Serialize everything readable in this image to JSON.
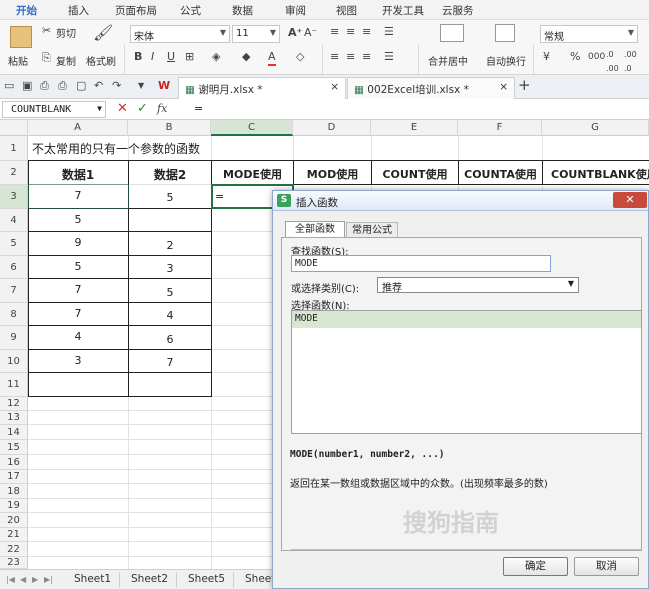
{
  "menu": {
    "items": [
      "开始",
      "插入",
      "页面布局",
      "公式",
      "数据",
      "审阅",
      "视图",
      "开发工具",
      "云服务"
    ]
  },
  "ribbon": {
    "paste": "粘贴",
    "cut": "剪切",
    "copy": "复制",
    "format_painter": "格式刷",
    "font_name": "宋体",
    "font_size": "11",
    "merge_center": "合并居中",
    "wrap": "自动换行",
    "number_format": "常规",
    "percent": "%",
    "thousand": "000"
  },
  "tabs": {
    "file1": "谢明月.xlsx *",
    "file2": "002Excel培训.xlsx *"
  },
  "formula_bar": {
    "name_box": "COUNTBLANK",
    "fx": "fx",
    "content": "="
  },
  "columns": [
    "A",
    "B",
    "C",
    "D",
    "E",
    "F",
    "G"
  ],
  "rows": [
    "1",
    "2",
    "3",
    "4",
    "5",
    "6",
    "7",
    "8",
    "9",
    "10",
    "11",
    "12",
    "13",
    "14",
    "15",
    "16",
    "17",
    "18",
    "19",
    "20",
    "21",
    "22",
    "23"
  ],
  "sheet": {
    "title": "不太常用的只有一个参数的函数",
    "headers": [
      "数据1",
      "数据2",
      "MODE使用",
      "MOD使用",
      "COUNT使用",
      "COUNTA使用",
      "COUNTBLANK使用"
    ],
    "data1": [
      "7",
      "5",
      "9",
      "5",
      "7",
      "7",
      "4",
      "3"
    ],
    "data2": [
      "5",
      "",
      "2",
      "3",
      "5",
      "4",
      "6",
      "7"
    ],
    "c3": "="
  },
  "sheet_tabs": [
    "Sheet1",
    "Sheet2",
    "Sheet5",
    "Sheet"
  ],
  "dialog": {
    "title": "插入函数",
    "tab_all": "全部函数",
    "tab_common": "常用公式",
    "search_label": "查找函数(S):",
    "search_value": "MODE",
    "category_label": "或选择类别(C):",
    "category_value": "推荐",
    "select_label": "选择函数(N):",
    "functions": [
      "MODE"
    ],
    "syntax": "MODE(number1, number2, ...)",
    "description": "返回在某一数组或数据区域中的众数。(出现频率最多的数)",
    "ok": "确定",
    "cancel": "取消"
  },
  "watermark": "搜狗指南",
  "colors": {
    "accent": "#2f6fc7",
    "selected_cell": "#217346",
    "list_highlight": "#d8e8d0"
  }
}
